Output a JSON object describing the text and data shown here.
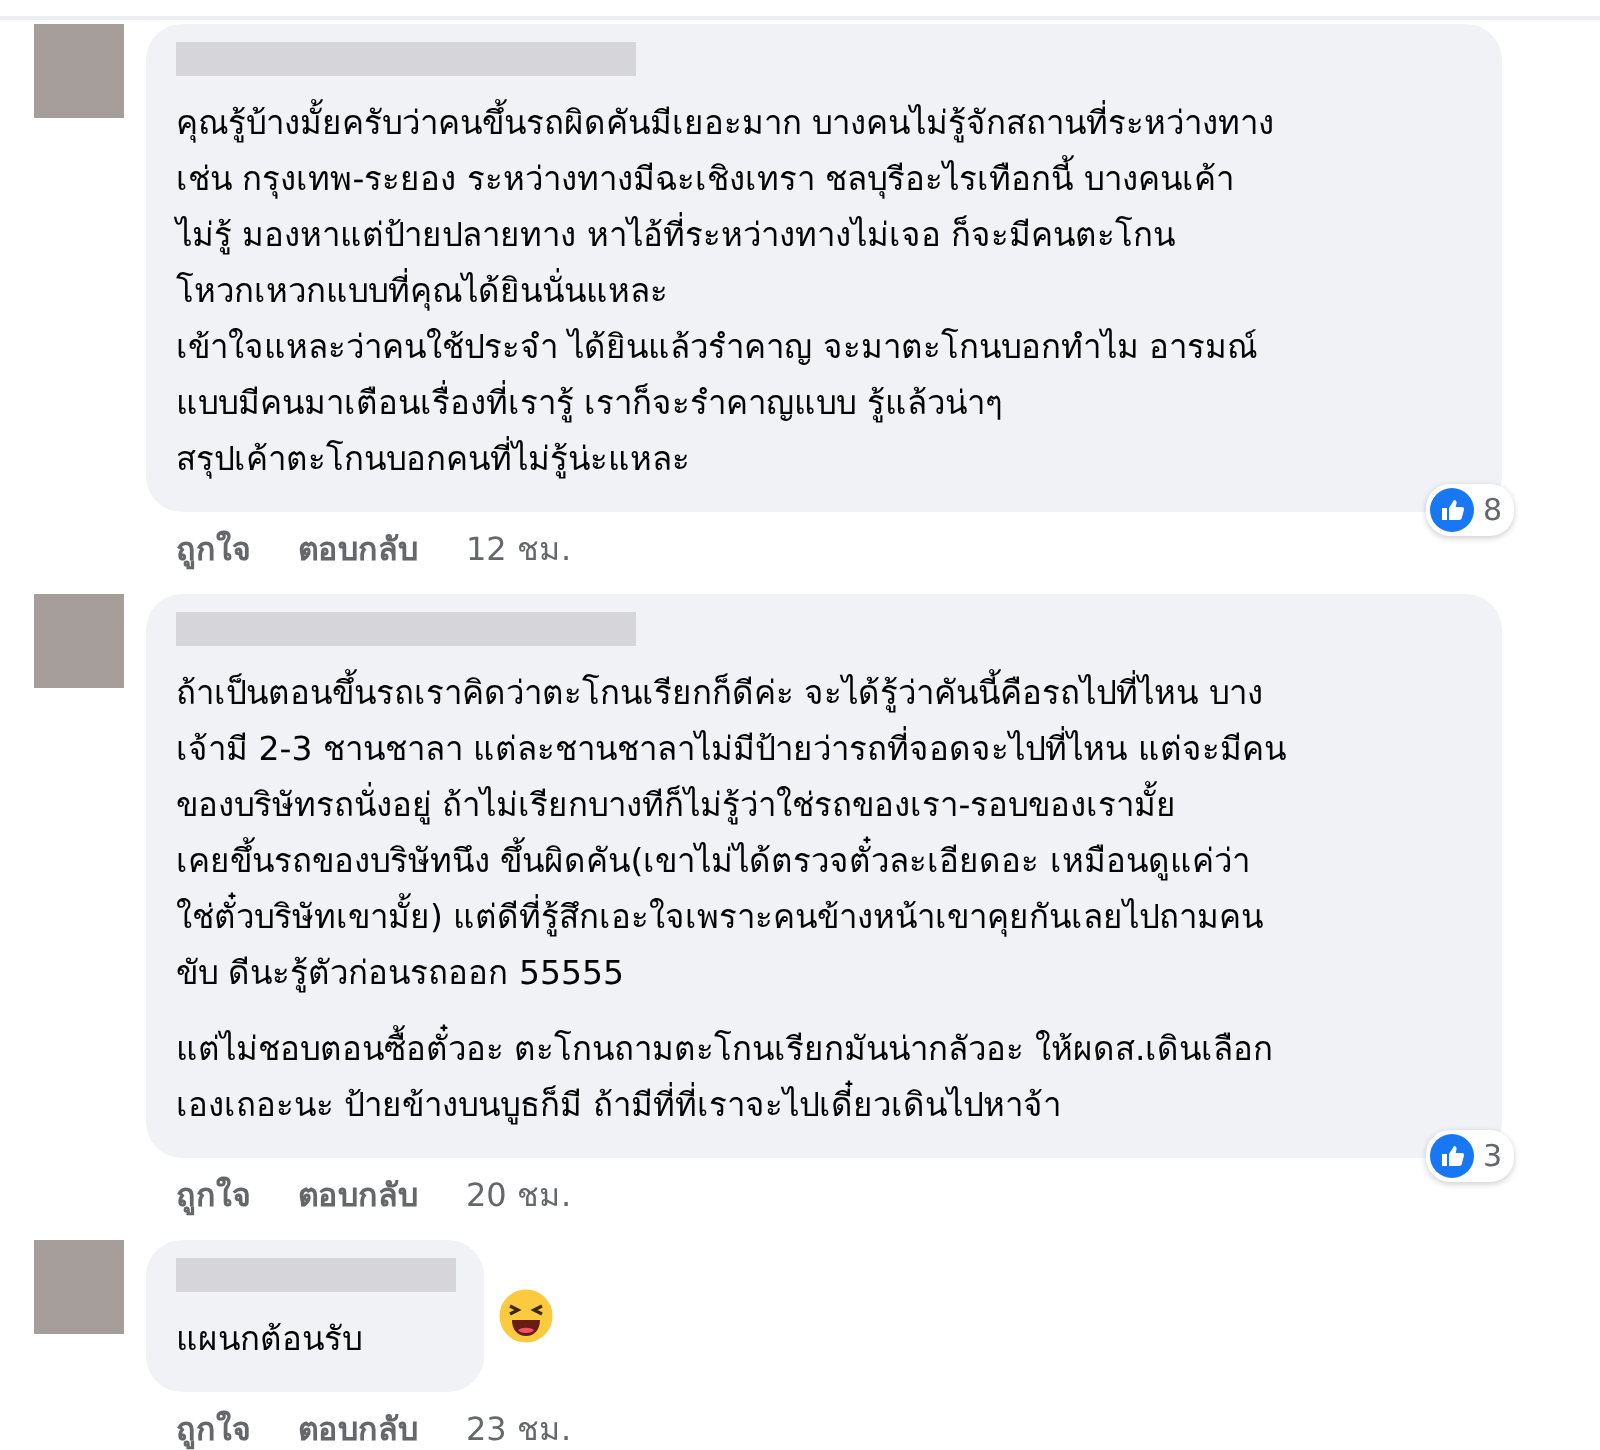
{
  "comments": [
    {
      "paragraphs": [
        "คุณรู้บ้างมั้ยครับว่าคนขึ้นรถผิดคันมีเยอะมาก บางคนไม่รู้จักสถานที่ระหว่างทาง\nเช่น กรุงเทพ-ระยอง ระหว่างทางมีฉะเชิงเทรา ชลบุรีอะไรเทือกนี้ บางคนเค้า\nไม่รู้ มองหาแต่ป้ายปลายทาง หาไอ้ที่ระหว่างทางไม่เจอ ก็จะมีคนตะโกน\nโหวกเหวกแบบที่คุณได้ยินนั่นแหละ\nเข้าใจแหละว่าคนใช้ประจำ ได้ยินแล้วรำคาญ จะมาตะโกนบอกทำไม อารมณ์\nแบบมีคนมาเตือนเรื่องที่เรารู้ เราก็จะรำคาญแบบ รู้แล้วน่าๆ\nสรุปเค้าตะโกนบอกคนที่ไม่รู้น่ะแหละ"
      ],
      "actions": [
        "ถูกใจ",
        "ตอบกลับ"
      ],
      "time": "12 ชม.",
      "reaction": {
        "kind": "like",
        "count": "8"
      }
    },
    {
      "paragraphs": [
        "ถ้าเป็นตอนขึ้นรถเราคิดว่าตะโกนเรียกก็ดีค่ะ จะได้รู้ว่าคันนี้คือรถไปที่ไหน บาง\nเจ้ามี 2-3 ชานชาลา แต่ละชานชาลาไม่มีป้ายว่ารถที่จอดจะไปที่ไหน แต่จะมีคน\nของบริษัทรถนั่งอยู่ ถ้าไม่เรียกบางทีก็ไม่รู้ว่าใช่รถของเรา-รอบของเรามั้ย\nเคยขึ้นรถของบริษัทนึง ขึ้นผิดคัน(เขาไม่ได้ตรวจตั๋วละเอียดอะ เหมือนดูแค่ว่า\nใช่ตั๋วบริษัทเขามั้ย) แต่ดีที่รู้สึกเอะใจเพราะคนข้างหน้าเขาคุยกันเลยไปถามคน\nขับ ดีนะรู้ตัวก่อนรถออก 55555",
        "แต่ไม่ชอบตอนซื้อตั๋วอะ ตะโกนถามตะโกนเรียกมันน่ากลัวอะ ให้ผดส.เดินเลือก\nเองเถอะนะ ป้ายข้างบนบูธก็มี ถ้ามีที่ที่เราจะไปเดี๋ยวเดินไปหาจ้า"
      ],
      "actions": [
        "ถูกใจ",
        "ตอบกลับ"
      ],
      "time": "20 ชม.",
      "reaction": {
        "kind": "like",
        "count": "3"
      }
    },
    {
      "paragraphs": [
        "แผนกต้อนรับ"
      ],
      "actions": [
        "ถูกใจ",
        "ตอบกลับ"
      ],
      "time": "23 ชม.",
      "reaction": {
        "kind": "haha"
      }
    }
  ]
}
